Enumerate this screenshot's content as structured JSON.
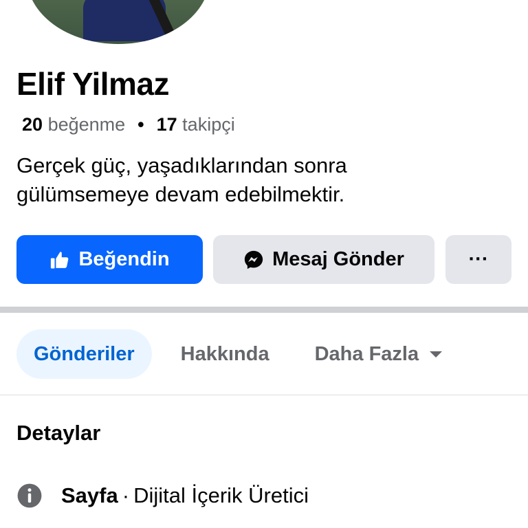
{
  "profile": {
    "name": "Elif Yilmaz",
    "likes_count": "20",
    "likes_label": "beğenme",
    "separator": "•",
    "followers_count": "17",
    "followers_label": "takipçi",
    "bio_line1": "Gerçek güç, yaşadıklarından sonra",
    "bio_line2": "gülümsemeye devam edebilmektir."
  },
  "actions": {
    "like_label": "Beğendin",
    "message_label": "Mesaj Gönder",
    "more_label": "···"
  },
  "tabs": [
    {
      "label": "Gönderiler",
      "active": true
    },
    {
      "label": "Hakkında",
      "active": false
    },
    {
      "label": "Daha Fazla",
      "active": false
    }
  ],
  "details": {
    "title": "Detaylar",
    "category_label": "Sayfa",
    "category_sep": "·",
    "category_value": "Dijital İçerik Üretici"
  },
  "colors": {
    "primary": "#0866ff",
    "active_tab_bg": "#ebf5ff",
    "active_tab_text": "#0064d1",
    "button_gray": "#e4e6eb",
    "secondary_text": "#65676b"
  },
  "icons": {
    "like": "thumbs-up-icon",
    "message": "messenger-icon",
    "more": "more-dots-icon",
    "dropdown": "caret-down-icon",
    "info": "info-icon"
  }
}
